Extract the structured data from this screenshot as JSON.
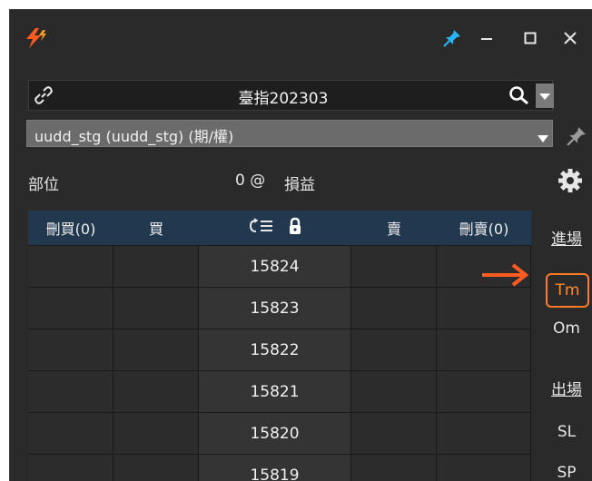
{
  "window": {
    "controls": [
      "pin",
      "minimize",
      "maximize",
      "close"
    ]
  },
  "symbol": {
    "name": "臺指202303",
    "search_icon": "search-icon"
  },
  "strategy": {
    "selected": "uudd_stg (uudd_stg) (期/權)"
  },
  "position": {
    "label": "部位",
    "value": "0 @",
    "pnl_label": "損益"
  },
  "table": {
    "headers": {
      "cancel_buy": "刪買(0)",
      "buy": "買",
      "cancel_sell": "刪賣(0)",
      "sell": "賣"
    },
    "prices": [
      "15824",
      "15823",
      "15822",
      "15821",
      "15820",
      "15819"
    ]
  },
  "sidebar": {
    "entry": "進場",
    "tm": "Tm",
    "om": "Om",
    "exit": "出場",
    "sl": "SL",
    "sp": "SP"
  },
  "colors": {
    "accent_orange": "#ff7a22",
    "logo_orange": "#ff5a1f",
    "pin_blue": "#29b6f6",
    "header_bg": "#21384f"
  }
}
